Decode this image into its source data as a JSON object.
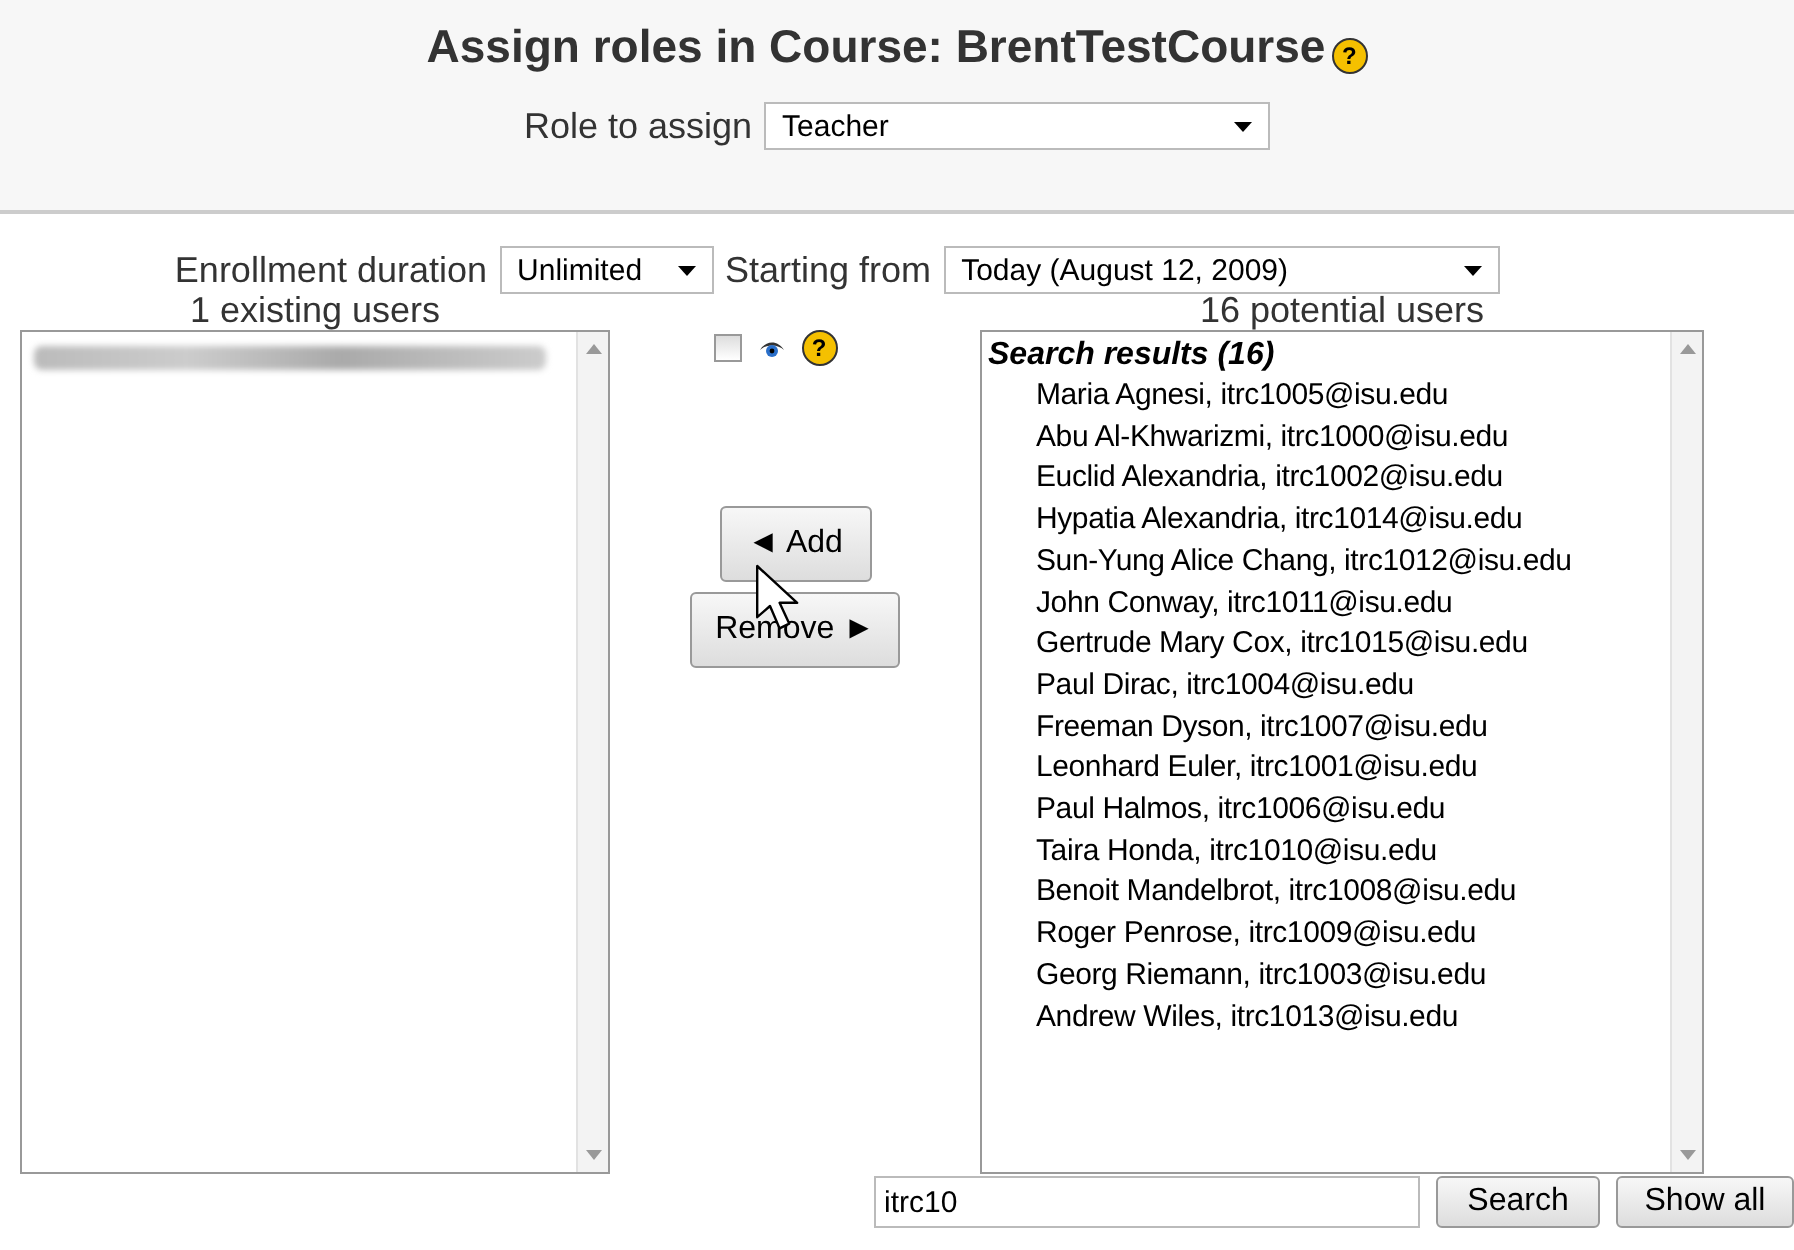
{
  "title": "Assign roles in Course: BrentTestCourse",
  "title_help": "?",
  "role_to_assign": {
    "label": "Role to assign",
    "value": "Teacher"
  },
  "enrollment_duration": {
    "label": "Enrollment duration",
    "value": "Unlimited"
  },
  "starting_from": {
    "label": "Starting from",
    "value": "Today (August 12, 2009)"
  },
  "existing_users": {
    "heading": "1 existing users"
  },
  "options": {
    "checked": false,
    "help": "?"
  },
  "add_button": "◄ Add",
  "remove_button": "Remove ►",
  "potential_users": {
    "heading": "16 potential users",
    "group": "Search results (16)",
    "items": [
      "Maria Agnesi, itrc1005@isu.edu",
      "Abu Al-Khwarizmi, itrc1000@isu.edu",
      "Euclid Alexandria, itrc1002@isu.edu",
      "Hypatia Alexandria, itrc1014@isu.edu",
      "Sun-Yung Alice Chang, itrc1012@isu.edu",
      "John Conway, itrc1011@isu.edu",
      "Gertrude Mary Cox, itrc1015@isu.edu",
      "Paul Dirac, itrc1004@isu.edu",
      "Freeman Dyson, itrc1007@isu.edu",
      "Leonhard Euler, itrc1001@isu.edu",
      "Paul Halmos, itrc1006@isu.edu",
      "Taira Honda, itrc1010@isu.edu",
      "Benoit Mandelbrot, itrc1008@isu.edu",
      "Roger Penrose, itrc1009@isu.edu",
      "Georg Riemann, itrc1003@isu.edu",
      "Andrew Wiles, itrc1013@isu.edu"
    ]
  },
  "search": {
    "value": "itrc10",
    "button": "Search",
    "show_all": "Show all"
  }
}
